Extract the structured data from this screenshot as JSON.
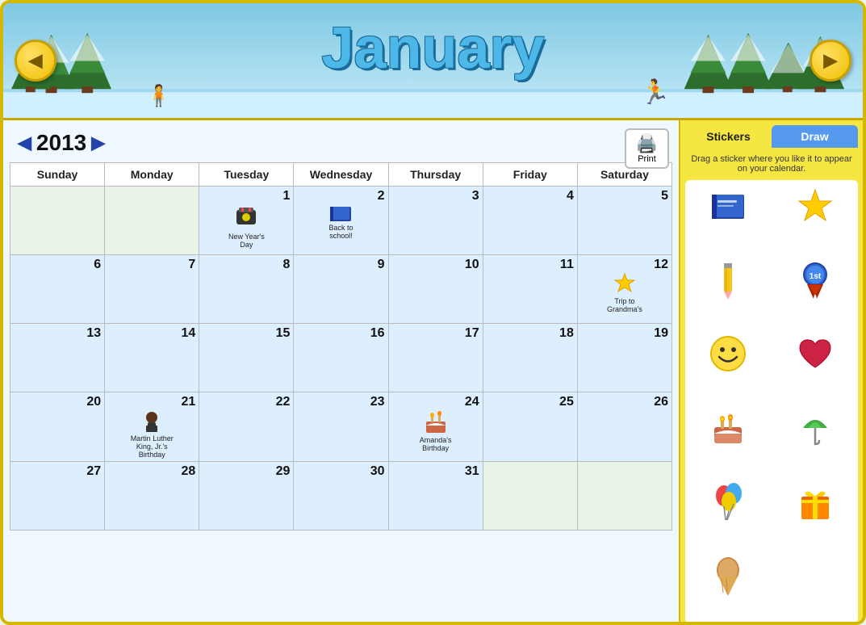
{
  "header": {
    "title": "January",
    "background_color": "#87ceeb"
  },
  "nav": {
    "prev_label": "◀",
    "next_label": "▶",
    "year": "2013",
    "year_prev": "◀",
    "year_next": "▶"
  },
  "days_of_week": [
    "Sunday",
    "Monday",
    "Tuesday",
    "Wednesday",
    "Thursday",
    "Friday",
    "Saturday"
  ],
  "weeks": [
    [
      {
        "day": "",
        "empty": true,
        "sticker": "",
        "event": ""
      },
      {
        "day": "",
        "empty": true,
        "sticker": "",
        "event": ""
      },
      {
        "day": "1",
        "empty": false,
        "sticker": "🎉",
        "event": "New Year's Day"
      },
      {
        "day": "2",
        "empty": false,
        "sticker": "📘",
        "event": "Back to school!"
      },
      {
        "day": "3",
        "empty": false,
        "sticker": "",
        "event": ""
      },
      {
        "day": "4",
        "empty": false,
        "sticker": "",
        "event": ""
      },
      {
        "day": "5",
        "empty": false,
        "sticker": "",
        "event": ""
      }
    ],
    [
      {
        "day": "6",
        "empty": false,
        "sticker": "",
        "event": ""
      },
      {
        "day": "7",
        "empty": false,
        "sticker": "",
        "event": ""
      },
      {
        "day": "8",
        "empty": false,
        "sticker": "",
        "event": ""
      },
      {
        "day": "9",
        "empty": false,
        "sticker": "",
        "event": ""
      },
      {
        "day": "10",
        "empty": false,
        "sticker": "",
        "event": ""
      },
      {
        "day": "11",
        "empty": false,
        "sticker": "",
        "event": ""
      },
      {
        "day": "12",
        "empty": false,
        "sticker": "⭐",
        "event": "Trip to Grandma's"
      }
    ],
    [
      {
        "day": "13",
        "empty": false,
        "sticker": "",
        "event": ""
      },
      {
        "day": "14",
        "empty": false,
        "sticker": "",
        "event": ""
      },
      {
        "day": "15",
        "empty": false,
        "sticker": "",
        "event": ""
      },
      {
        "day": "16",
        "empty": false,
        "sticker": "",
        "event": ""
      },
      {
        "day": "17",
        "empty": false,
        "sticker": "",
        "event": ""
      },
      {
        "day": "18",
        "empty": false,
        "sticker": "",
        "event": ""
      },
      {
        "day": "19",
        "empty": false,
        "sticker": "",
        "event": ""
      }
    ],
    [
      {
        "day": "20",
        "empty": false,
        "sticker": "",
        "event": ""
      },
      {
        "day": "21",
        "empty": false,
        "sticker": "👤",
        "event": "Martin Luther King, Jr.'s Birthday"
      },
      {
        "day": "22",
        "empty": false,
        "sticker": "",
        "event": ""
      },
      {
        "day": "23",
        "empty": false,
        "sticker": "",
        "event": ""
      },
      {
        "day": "24",
        "empty": false,
        "sticker": "🎂",
        "event": "Amanda's Birthday"
      },
      {
        "day": "25",
        "empty": false,
        "sticker": "",
        "event": ""
      },
      {
        "day": "26",
        "empty": false,
        "sticker": "",
        "event": ""
      }
    ],
    [
      {
        "day": "27",
        "empty": false,
        "sticker": "",
        "event": ""
      },
      {
        "day": "28",
        "empty": false,
        "sticker": "",
        "event": ""
      },
      {
        "day": "29",
        "empty": false,
        "sticker": "",
        "event": ""
      },
      {
        "day": "30",
        "empty": false,
        "sticker": "",
        "event": ""
      },
      {
        "day": "31",
        "empty": false,
        "sticker": "",
        "event": ""
      },
      {
        "day": "",
        "empty": true,
        "sticker": "",
        "event": ""
      },
      {
        "day": "",
        "empty": true,
        "sticker": "",
        "event": ""
      }
    ]
  ],
  "sidebar": {
    "tabs": [
      {
        "label": "Stickers",
        "active": true
      },
      {
        "label": "Draw",
        "active": false
      }
    ],
    "description": "Drag a sticker where you like it to appear on your calendar.",
    "stickers": [
      {
        "emoji": "📘",
        "name": "book"
      },
      {
        "emoji": "⭐",
        "name": "star"
      },
      {
        "emoji": "✏️",
        "name": "pencil"
      },
      {
        "emoji": "🏅",
        "name": "ribbon"
      },
      {
        "emoji": "😊",
        "name": "smiley"
      },
      {
        "emoji": "❤️",
        "name": "heart"
      },
      {
        "emoji": "🎂",
        "name": "cake"
      },
      {
        "emoji": "☂️",
        "name": "umbrella"
      },
      {
        "emoji": "🎈",
        "name": "balloons"
      },
      {
        "emoji": "🎁",
        "name": "gift"
      },
      {
        "emoji": "🍦",
        "name": "icecream"
      }
    ]
  },
  "print": {
    "label": "Print",
    "icon": "🖨️"
  }
}
